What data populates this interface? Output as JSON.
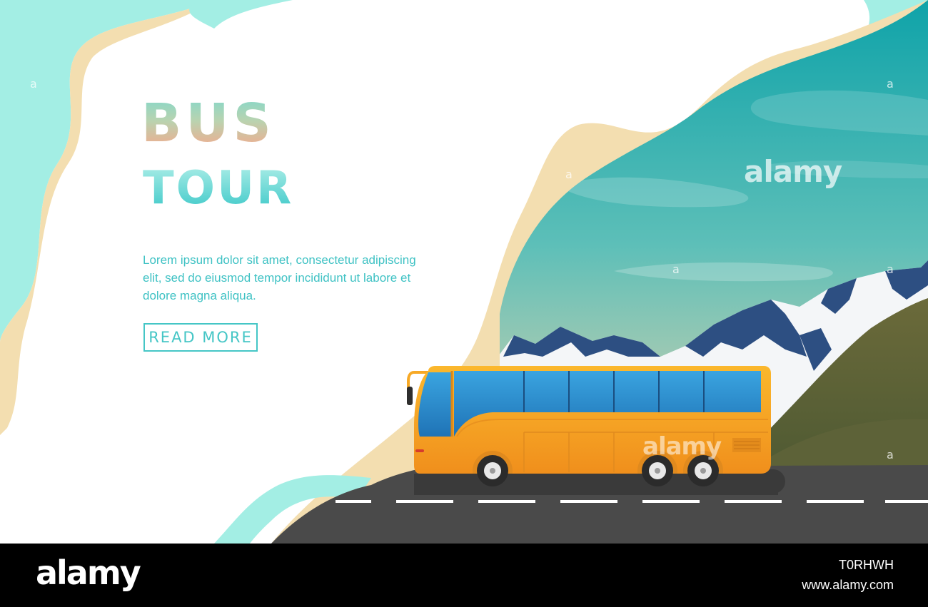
{
  "hero": {
    "title_line1": "BUS",
    "title_line2": "TOUR",
    "body": "Lorem ipsum dolor sit amet, consectetur adipiscing elit, sed do eiusmod tempor incididunt ut labore et dolore magna aliqua.",
    "cta_label": "READ MORE"
  },
  "watermark": {
    "text": "alamy",
    "mark": "a"
  },
  "footer": {
    "logo": "alamy",
    "image_id": "T0RHWH",
    "url": "www.alamy.com"
  },
  "colors": {
    "accent_teal": "#45c6c6",
    "mint": "#a3eee4",
    "sand": "#f3deb0",
    "bus_orange": "#f7a926",
    "window_blue": "#2e8ccc",
    "road": "#4a4a4a"
  },
  "icons": [
    "mountain-icon",
    "bus-icon",
    "road-icon"
  ]
}
